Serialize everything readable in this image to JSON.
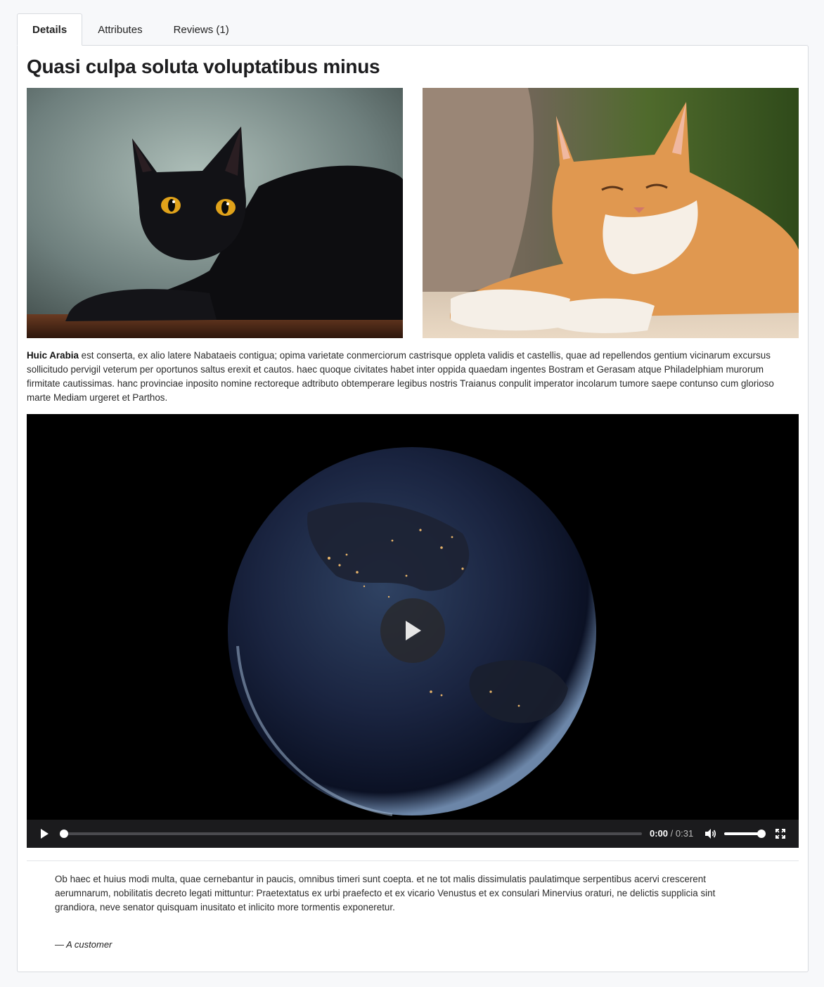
{
  "tabs": [
    {
      "label": "Details",
      "active": true
    },
    {
      "label": "Attributes",
      "active": false
    },
    {
      "label": "Reviews (1)",
      "active": false
    }
  ],
  "product": {
    "title": "Quasi culpa soluta voluptatibus minus",
    "description_bold": "Huic Arabia",
    "description_rest": " est conserta, ex alio latere Nabataeis contigua; opima varietate conmerciorum castrisque oppleta validis et castellis, quae ad repellendos gentium vicinarum excursus sollicitudo pervigil veterum per oportunos saltus erexit et cautos. haec quoque civitates habet inter oppida quaedam ingentes Bostram et Gerasam atque Philadelphiam murorum firmitate cautissimas. hanc provinciae inposito nomine rectoreque adtributo obtemperare legibus nostris Traianus conpulit imperator incolarum tumore saepe contunso cum glorioso marte Mediam urgeret et Parthos."
  },
  "video": {
    "current_time": "0:00",
    "separator": "/",
    "duration": "0:31",
    "progress_fraction": 0.0,
    "volume_fraction": 1.0
  },
  "review": {
    "text": "Ob haec et huius modi multa, quae cernebantur in paucis, omnibus timeri sunt coepta. et ne tot malis dissimulatis paulatimque serpentibus acervi crescerent aerumnarum, nobilitatis decreto legati mittuntur: Praetextatus ex urbi praefecto et ex vicario Venustus et ex consulari Minervius oraturi, ne delictis supplicia sint grandiora, neve senator quisquam inusitato et inlicito more tormentis exponeretur.",
    "author": "— A customer"
  },
  "colors": {
    "page_bg": "#f7f8fa",
    "border": "#d8dbe0",
    "video_bg": "#000000",
    "controls_bg": "#1b1b1d"
  },
  "icons": [
    "play-icon",
    "big-play-icon",
    "volume-icon",
    "fullscreen-icon"
  ]
}
